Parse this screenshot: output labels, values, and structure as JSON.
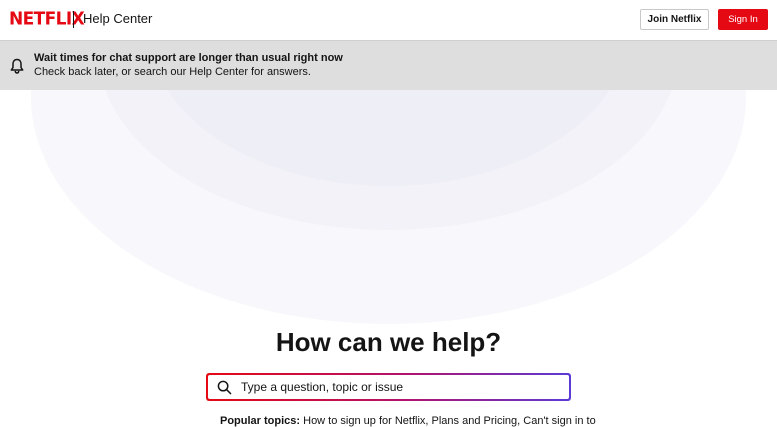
{
  "header": {
    "logo": "NETFLIX",
    "title": "Help Center",
    "join_label": "Join Netflix",
    "signin_label": "Sign In"
  },
  "banner": {
    "icon": "bell-icon",
    "title": "Wait times for chat support are longer than usual right now",
    "subtitle": "Check back later, or search our Help Center for answers."
  },
  "hero": {
    "headline": "How can we help?",
    "search": {
      "icon": "search-icon",
      "placeholder": "Type a question, topic or issue",
      "value": ""
    },
    "popular": {
      "label": "Popular topics:",
      "topics": [
        "How to sign up for Netflix",
        "Plans and Pricing",
        "Can't sign in to"
      ]
    }
  },
  "colors": {
    "brand": "#e50914",
    "banner_bg": "#dedede",
    "gradient_end": "#5b3bd6"
  }
}
